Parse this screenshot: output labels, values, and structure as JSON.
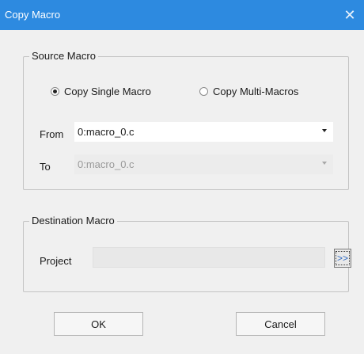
{
  "window": {
    "title": "Copy Macro",
    "close_glyph": "✕"
  },
  "source_group": {
    "legend": "Source Macro",
    "radio_single": {
      "label": "Copy Single Macro",
      "checked": true
    },
    "radio_multi": {
      "label": "Copy Multi-Macros",
      "checked": false
    },
    "from_label": "From",
    "from_value": "0:macro_0.c",
    "to_label": "To",
    "to_value": "0:macro_0.c"
  },
  "destination_group": {
    "legend": "Destination Macro",
    "project_label": "Project",
    "project_value": "",
    "browse_label": ">>"
  },
  "buttons": {
    "ok": "OK",
    "cancel": "Cancel"
  },
  "colors": {
    "titlebar": "#2d8ae0",
    "dialog_bg": "#f0f0f0"
  }
}
